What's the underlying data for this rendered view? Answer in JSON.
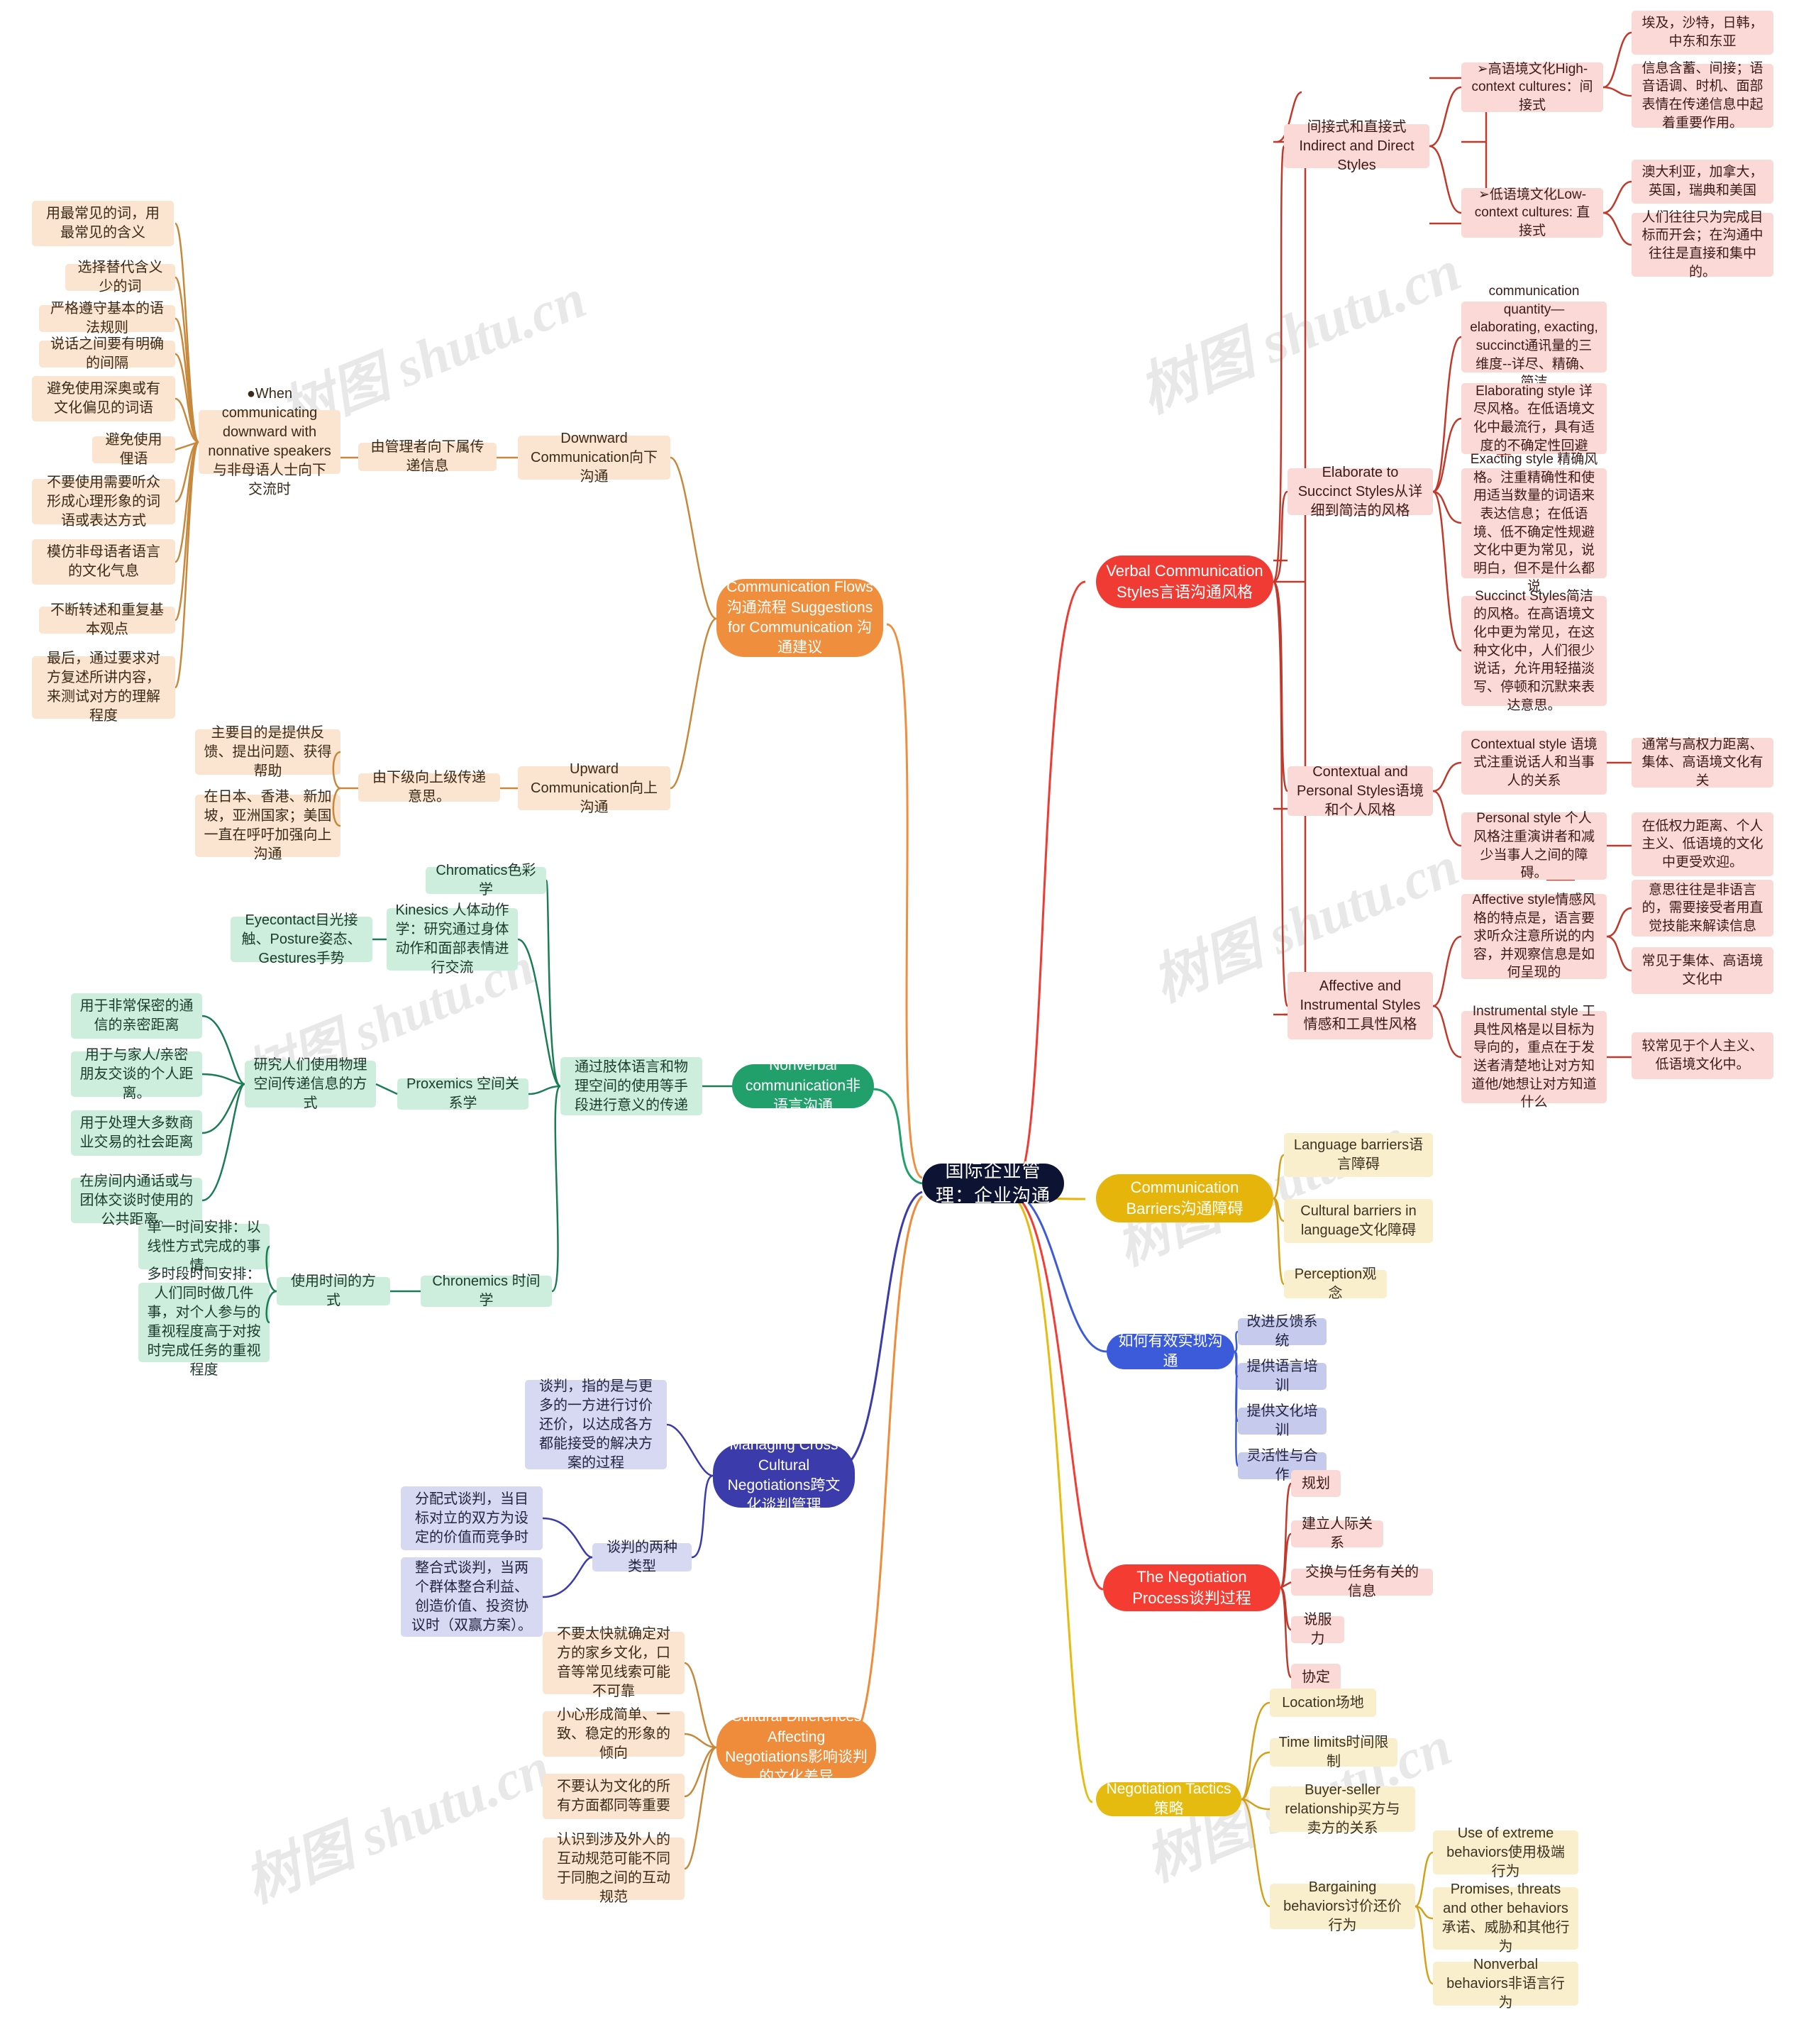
{
  "root": {
    "label": "国际企业管理：企业沟通"
  },
  "watermarks": [
    "树图 shutu.cn",
    "树图 shutu.cn",
    "树图 shutu.cn",
    "树图 shutu.cn",
    "树图 shutu.cn",
    "树图 shutu.cn",
    "树图 shutu.cn"
  ],
  "colors": {
    "root_bg": "#0d1333",
    "verbal": "#ef3b33",
    "barriers": "#e5b50c",
    "effective": "#3b5bdb",
    "negotiation_process": "#f43c32",
    "negotiation_tactics": "#e6bb10",
    "comm_flows": "#ef8f3e",
    "nonverbal": "#22a06b",
    "cross_cultural": "#3b3bab",
    "cultural_diff": "#ee8c3c",
    "pink_leaf": "#fbd9d6",
    "cream_leaf": "#faefcd",
    "lavender_leaf": "#d7d9f2",
    "peach_leaf": "#fbe4d0",
    "mint_leaf": "#cdeedd"
  },
  "branches": {
    "verbal": {
      "label": "Verbal Communication Styles言语沟通风格",
      "children": {
        "indirect_direct": {
          "label": "间接式和直接式 Indirect and Direct Styles",
          "high_context": {
            "label": "➢高语境文化High-context cultures：间接式",
            "notes": [
              "埃及，沙特，日韩，中东和东亚",
              "信息含蓄、间接；语音语调、时机、面部表情在传递信息中起着重要作用。"
            ]
          },
          "low_context": {
            "label": "➢低语境文化Low-context cultures: 直接式",
            "notes": [
              "澳大利亚，加拿大，英国，瑞典和美国",
              "人们往往只为完成目标而开会；在沟通中往往是直接和集中的。"
            ]
          }
        },
        "elaborate_succinct": {
          "label": "Elaborate to Succinct Styles从详细到简洁的风格",
          "notes": [
            "communication quantity—elaborating, exacting, succinct通讯量的三维度--详尽、精确、简洁",
            "Elaborating style 详尽风格。在低语境文化中最流行，具有适度的不确定性回避",
            "Exacting style 精确风格。注重精确性和使用适当数量的词语来表达信息；在低语境、低不确定性规避文化中更为常见，说明白，但不是什么都说",
            "Succinct Styles简洁的风格。在高语境文化中更为常见，在这种文化中，人们很少说话，允许用轻描淡写、停顿和沉默来表达意思。"
          ]
        },
        "contextual_personal": {
          "label": "Contextual and Personal Styles语境和个人风格",
          "items": [
            {
              "label": "Contextual style 语境式注重说话人和当事人的关系",
              "note": "通常与高权力距离、集体、高语境文化有关"
            },
            {
              "label": "Personal style 个人风格注重演讲者和减少当事人之间的障碍。",
              "note": "在低权力距离、个人主义、低语境的文化中更受欢迎。"
            }
          ]
        },
        "affective_instrumental": {
          "label": "Affective and Instrumental Styles情感和工具性风格",
          "items": [
            {
              "label": "Affective style情感风格的特点是，语言要求听众注意所说的内容，并观察信息是如何呈现的",
              "notes": [
                "意思往往是非语言的，需要接受者用直觉技能来解读信息",
                "常见于集体、高语境文化中"
              ]
            },
            {
              "label": "Instrumental style 工具性风格是以目标为导向的，重点在于发送者清楚地让对方知道他/她想让对方知道什么",
              "notes": [
                "较常见于个人主义、低语境文化中。"
              ]
            }
          ]
        }
      }
    },
    "barriers": {
      "label": "Communication Barriers沟通障碍",
      "items": [
        "Language barriers语言障碍",
        "Cultural barriers in language文化障碍",
        "Perception观念"
      ]
    },
    "effective": {
      "label": "如何有效实现沟通",
      "items": [
        "改进反馈系统",
        "提供语言培训",
        "提供文化培训",
        "灵活性与合作"
      ]
    },
    "negotiation_process": {
      "label": "The Negotiation Process谈判过程",
      "items": [
        "规划",
        "建立人际关系",
        "交换与任务有关的信息",
        "说服力",
        "协定"
      ]
    },
    "negotiation_tactics": {
      "label": "Negotiation Tactics策略",
      "items": [
        {
          "label": "Location场地"
        },
        {
          "label": "Time limits时间限制"
        },
        {
          "label": "Buyer-seller relationship买方与卖方的关系"
        },
        {
          "label": "Bargaining behaviors讨价还价行为",
          "children": [
            "Use of extreme behaviors使用极端行为",
            "Promises, threats and other behaviors承诺、威胁和其他行为",
            "Nonverbal behaviors非语言行为"
          ]
        }
      ]
    },
    "comm_flows": {
      "label": "Communication Flows沟通流程 Suggestions for Communication 沟通建议",
      "downward": {
        "label": "Downward Communication向下沟通",
        "mid": "由管理者向下属传递信息",
        "sub": {
          "label": "●When communicating downward with nonnative speakers与非母语人士向下交流时",
          "tips": [
            "用最常见的词，用最常见的含义",
            "选择替代含义少的词",
            "严格遵守基本的语法规则",
            "说话之间要有明确的间隔",
            "避免使用深奥或有文化偏见的词语",
            "避免使用俚语",
            "不要使用需要听众形成心理形象的词语或表达方式",
            "模仿非母语者语言的文化气息",
            "不断转述和重复基本观点",
            "最后，通过要求对方复述所讲内容，来测试对方的理解程度"
          ]
        }
      },
      "upward": {
        "label": "Upward Communication向上沟通",
        "mid": "由下级向上级传递意思。",
        "tips": [
          "主要目的是提供反馈、提出问题、获得帮助",
          "在日本、香港、新加坡，亚洲国家；美国一直在呼吁加强向上沟通"
        ]
      }
    },
    "nonverbal": {
      "label": "Nonverbal communication非语言沟通",
      "mid": "通过肢体语言和物理空间的使用等手段进行意义的传递",
      "kinesics": {
        "label": "Kinesics 人体动作学：研究通过身体动作和面部表情进行交流",
        "detail": "Eyecontact目光接触、Posture姿态、Gestures手势",
        "chromatics": "Chromatics色彩学"
      },
      "proxemics": {
        "label": "Proxemics 空间关系学",
        "detail": "研究人们使用物理空间传递信息的方式",
        "distances": [
          "用于非常保密的通信的亲密距离",
          "用于与家人/亲密朋友交谈的个人距离。",
          "用于处理大多数商业交易的社会距离",
          "在房间内通话或与团体交谈时使用的公共距离。"
        ]
      },
      "chronemics": {
        "label": "Chronemics 时间学",
        "detail": "使用时间的方式",
        "types": [
          "单一时间安排：以线性方式完成的事情。",
          "多时段时间安排：人们同时做几件事，对个人参与的重视程度高于对按时完成任务的重视程度"
        ]
      }
    },
    "cross_cultural": {
      "label": "Managing Cross Cultural Negotiations跨文化谈判管理",
      "definition": "谈判，指的是与更多的一方进行讨价还价，以达成各方都能接受的解决方案的过程",
      "two_types": {
        "label": "谈判的两种类型",
        "items": [
          "分配式谈判，当目标对立的双方为设定的价值而竞争时",
          "整合式谈判，当两个群体整合利益、创造价值、投资协议时（双赢方案）。"
        ]
      }
    },
    "cultural_diff": {
      "label": "Cultural Differences  Affecting Negotiations影响谈判的文化差异",
      "items": [
        "不要太快就确定对方的家乡文化，口音等常见线索可能不可靠",
        "小心形成简单、一致、稳定的形象的倾向",
        "不要认为文化的所有方面都同等重要",
        "认识到涉及外人的互动规范可能不同于同胞之间的互动规范"
      ]
    }
  }
}
